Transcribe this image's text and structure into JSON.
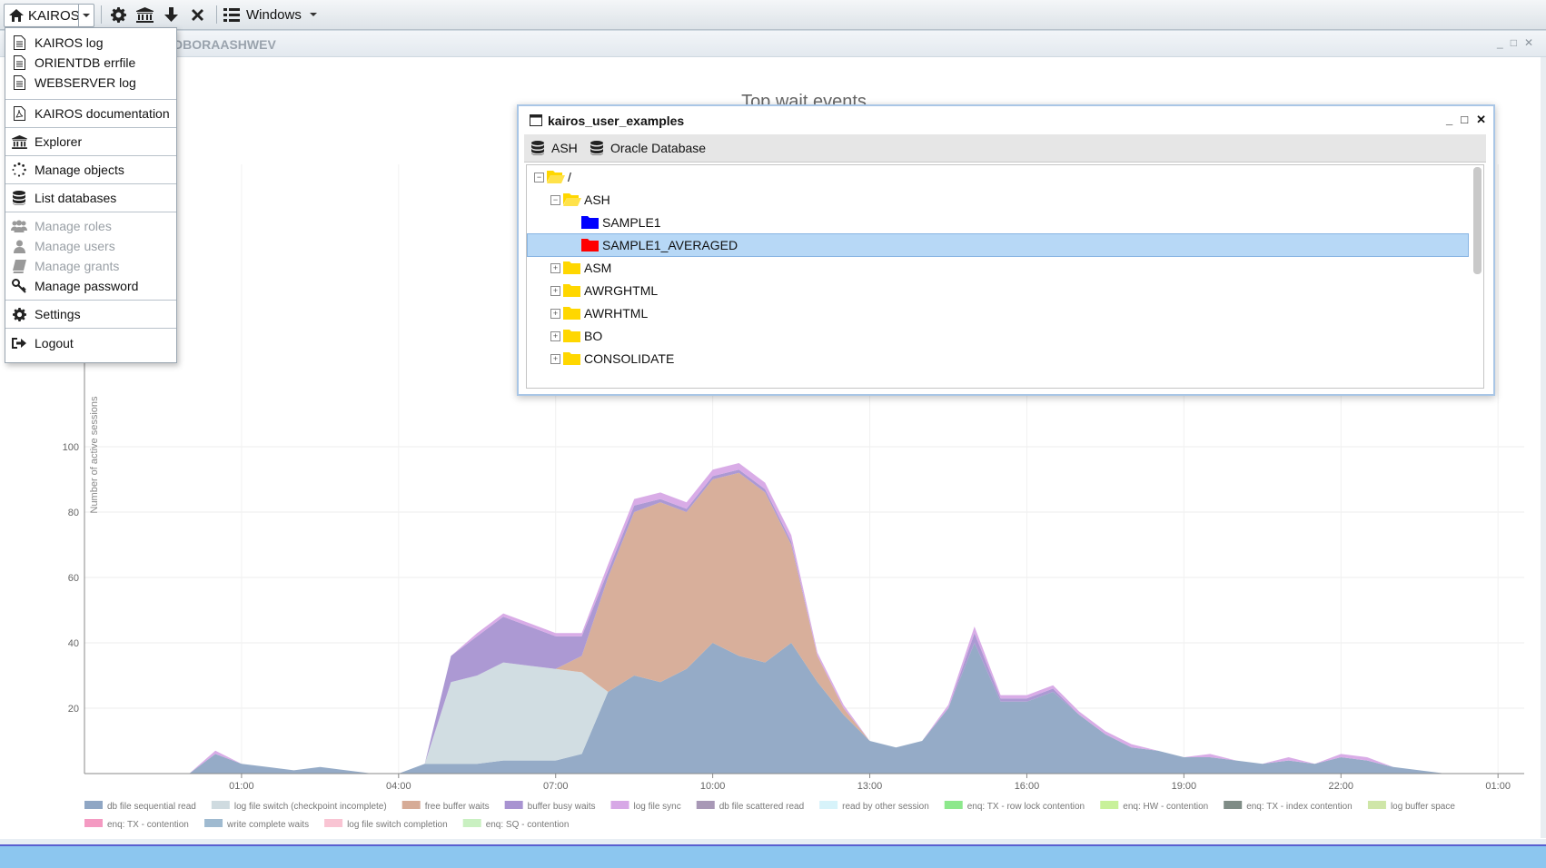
{
  "topbar": {
    "app_label": "KAIROS",
    "windows_label": "Windows"
  },
  "chart_window": {
    "title": "DBORAASHWEV"
  },
  "menu": {
    "items": [
      {
        "label": "KAIROS log",
        "icon": "document-icon",
        "enabled": true
      },
      {
        "label": "ORIENTDB errfile",
        "icon": "document-icon",
        "enabled": true
      },
      {
        "label": "WEBSERVER log",
        "icon": "document-icon",
        "enabled": true
      },
      {
        "label": "KAIROS documentation",
        "icon": "pdf-icon",
        "enabled": true
      },
      {
        "label": "Explorer",
        "icon": "bank-icon",
        "enabled": true
      },
      {
        "label": "Manage objects",
        "icon": "spinner-icon",
        "enabled": true
      },
      {
        "label": "List databases",
        "icon": "database-icon",
        "enabled": true
      },
      {
        "label": "Manage roles",
        "icon": "users-icon",
        "enabled": false
      },
      {
        "label": "Manage users",
        "icon": "user-icon",
        "enabled": false
      },
      {
        "label": "Manage grants",
        "icon": "book-icon",
        "enabled": false
      },
      {
        "label": "Manage password",
        "icon": "key-icon",
        "enabled": true
      },
      {
        "label": "Settings",
        "icon": "gear-icon",
        "enabled": true
      },
      {
        "label": "Logout",
        "icon": "logout-icon",
        "enabled": true
      }
    ]
  },
  "dialog": {
    "title": "kairos_user_examples",
    "toolbar": {
      "ash": "ASH",
      "oracle": "Oracle Database"
    },
    "tree": [
      {
        "label": "/",
        "folder": "open",
        "color": "#ffd700"
      },
      {
        "label": "ASH",
        "folder": "open",
        "color": "#ffd700"
      },
      {
        "label": "SAMPLE1",
        "folder": "closed",
        "color": "#0000ff"
      },
      {
        "label": "SAMPLE1_AVERAGED",
        "folder": "closed",
        "color": "#ff0000",
        "selected": true
      },
      {
        "label": "ASM",
        "folder": "closed",
        "color": "#ffd700"
      },
      {
        "label": "AWRGHTML",
        "folder": "closed",
        "color": "#ffd700"
      },
      {
        "label": "AWRHTML",
        "folder": "closed",
        "color": "#ffd700"
      },
      {
        "label": "BO",
        "folder": "closed",
        "color": "#ffd700"
      },
      {
        "label": "CONSOLIDATE",
        "folder": "closed",
        "color": "#ffd700"
      }
    ]
  },
  "chart_data": {
    "type": "area",
    "title": "Top wait events",
    "ylabel": "Number of active sessions",
    "yticks": [
      20,
      40,
      60,
      80,
      100
    ],
    "ylim": [
      0,
      110
    ],
    "xticks": [
      "01:00",
      "04:00",
      "07:00",
      "10:00",
      "13:00",
      "16:00",
      "19:00",
      "22:00",
      "01:00"
    ],
    "grid": true,
    "legend_position": "bottom",
    "legend": [
      {
        "name": "db file sequential read",
        "color": "#8fa6c4"
      },
      {
        "name": "log file switch (checkpoint incomplete)",
        "color": "#cfdbe0"
      },
      {
        "name": "free buffer waits",
        "color": "#d6ab96"
      },
      {
        "name": "buffer busy waits",
        "color": "#a893d1"
      },
      {
        "name": "log file sync",
        "color": "#d7a8e6"
      },
      {
        "name": "db file scattered read",
        "color": "#a898b6"
      },
      {
        "name": "read by other session",
        "color": "#d7f3fa"
      },
      {
        "name": "enq: TX - row lock contention",
        "color": "#8de88c"
      },
      {
        "name": "enq: HW - contention",
        "color": "#c8f19a"
      },
      {
        "name": "enq: TX - index contention",
        "color": "#7f8c86"
      },
      {
        "name": "log buffer space",
        "color": "#cfe6a8"
      },
      {
        "name": "enq: TX - contention",
        "color": "#f49ac2"
      },
      {
        "name": "write complete waits",
        "color": "#9fbad0"
      },
      {
        "name": "log file switch completion",
        "color": "#f9c4d3"
      },
      {
        "name": "enq: SQ - contention",
        "color": "#c9f0c1"
      }
    ],
    "x_hours": [
      0,
      0.5,
      1,
      1.5,
      2,
      2.5,
      3,
      3.5,
      4,
      4.5,
      5,
      5.5,
      6,
      6.5,
      7,
      7.5,
      8,
      8.5,
      9,
      9.5,
      10,
      10.5,
      11,
      11.5,
      12,
      12.5,
      13,
      13.5,
      14,
      14.5,
      15,
      15.5,
      16,
      16.5,
      17,
      17.5,
      18,
      18.5,
      19,
      19.5,
      20,
      20.5,
      21,
      21.5,
      22,
      22.5,
      23,
      23.5,
      24,
      24.5,
      25
    ],
    "series": [
      {
        "name": "db file sequential read",
        "values": [
          0,
          6,
          3,
          2,
          1,
          2,
          1,
          0,
          0,
          3,
          3,
          3,
          4,
          4,
          4,
          6,
          25,
          30,
          28,
          32,
          40,
          36,
          34,
          40,
          28,
          18,
          10,
          8,
          10,
          20,
          40,
          22,
          22,
          25,
          18,
          12,
          8,
          7,
          5,
          5,
          4,
          3,
          4,
          3,
          5,
          4,
          2,
          1,
          0,
          0,
          0
        ]
      },
      {
        "name": "log file switch (checkpoint incomplete)",
        "values": [
          0,
          0,
          0,
          0,
          0,
          0,
          0,
          0,
          0,
          0,
          25,
          27,
          30,
          29,
          28,
          25,
          0,
          0,
          0,
          0,
          0,
          0,
          0,
          0,
          0,
          0,
          0,
          0,
          0,
          0,
          0,
          0,
          0,
          0,
          0,
          0,
          0,
          0,
          0,
          0,
          0,
          0,
          0,
          0,
          0,
          0,
          0,
          0,
          0,
          0,
          0
        ]
      },
      {
        "name": "free buffer waits",
        "values": [
          0,
          0,
          0,
          0,
          0,
          0,
          0,
          0,
          0,
          0,
          0,
          0,
          0,
          0,
          0,
          5,
          35,
          50,
          55,
          48,
          50,
          56,
          52,
          30,
          8,
          2,
          0,
          0,
          0,
          0,
          0,
          0,
          0,
          0,
          0,
          0,
          0,
          0,
          0,
          0,
          0,
          0,
          0,
          0,
          0,
          0,
          0,
          0,
          0,
          0,
          0
        ]
      },
      {
        "name": "buffer busy waits",
        "values": [
          0,
          0,
          0,
          0,
          0,
          0,
          0,
          0,
          0,
          0,
          8,
          12,
          14,
          12,
          10,
          6,
          2,
          2,
          1,
          1,
          1,
          1,
          1,
          1,
          0,
          0,
          0,
          0,
          0,
          0,
          3,
          1,
          1,
          1,
          0,
          0,
          0,
          0,
          0,
          0,
          0,
          0,
          0,
          0,
          0,
          0,
          0,
          0,
          0,
          0,
          0
        ]
      },
      {
        "name": "log file sync",
        "values": [
          0,
          1,
          0,
          0,
          0,
          0,
          0,
          0,
          0,
          0,
          0,
          1,
          1,
          1,
          1,
          1,
          2,
          2,
          2,
          2,
          2,
          2,
          2,
          2,
          1,
          1,
          0,
          0,
          0,
          1,
          2,
          1,
          1,
          1,
          1,
          1,
          1,
          0,
          0,
          1,
          0,
          0,
          1,
          0,
          1,
          1,
          0,
          0,
          0,
          0,
          0
        ]
      }
    ]
  }
}
